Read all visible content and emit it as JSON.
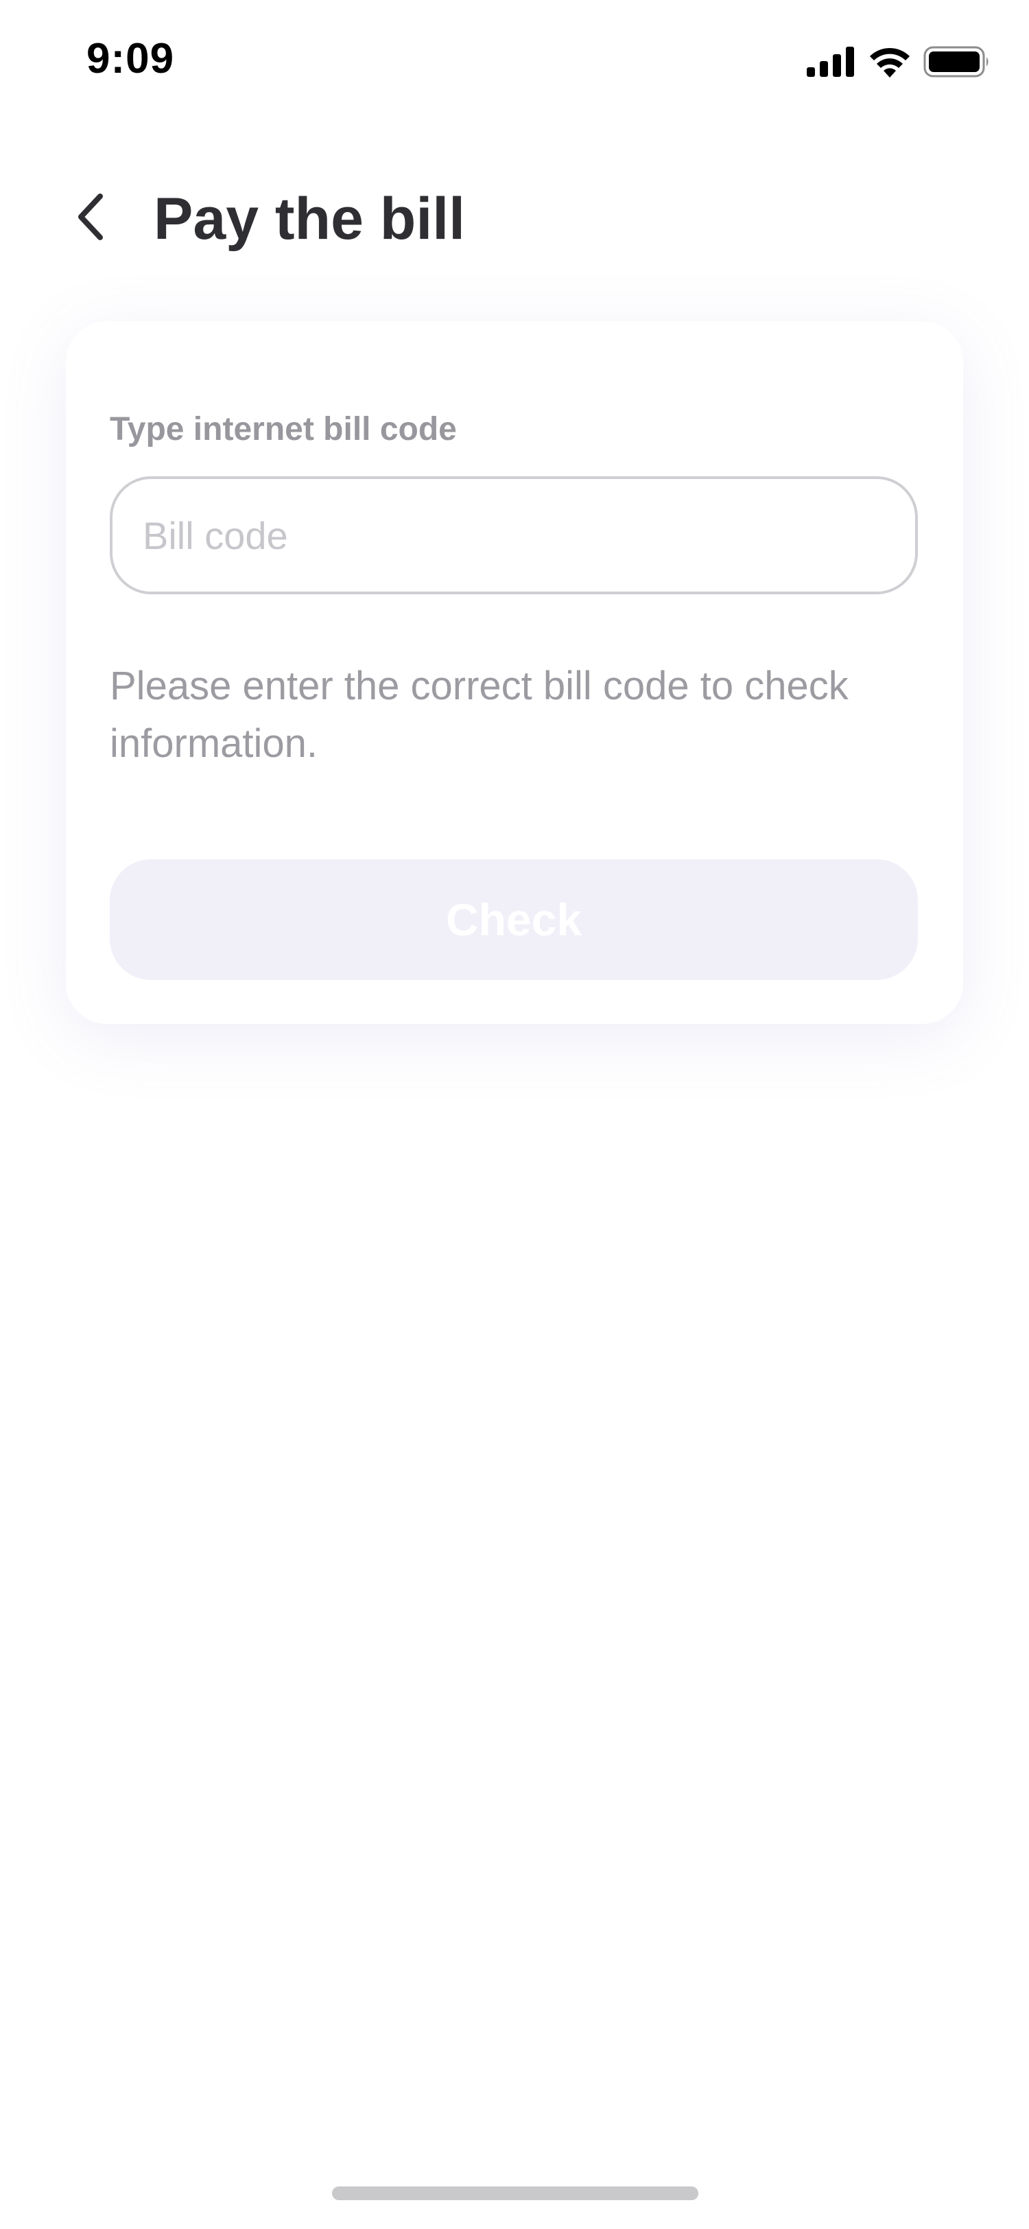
{
  "status_bar": {
    "time": "9:09",
    "icons": [
      "cellular-signal-icon",
      "wifi-icon",
      "battery-icon"
    ]
  },
  "header": {
    "back_icon": "chevron-left-icon",
    "title": "Pay the bill"
  },
  "form": {
    "label": "Type internet bill code",
    "input_value": "",
    "input_placeholder": "Bill code",
    "hint": "Please enter the correct bill code to check information.",
    "button_label": "Check"
  },
  "colors": {
    "title": "#2f2f33",
    "label": "#97979d",
    "input_border": "#cfcfd3",
    "placeholder": "#c6c6cb",
    "hint": "#9b9ba1",
    "button_bg_disabled": "#f1f0f9",
    "button_text": "#ffffff",
    "home_indicator": "#c9c9cc"
  }
}
